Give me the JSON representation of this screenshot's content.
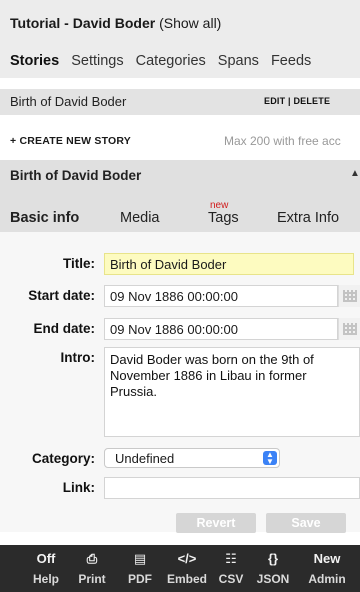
{
  "header": {
    "title_bold": "Tutorial - David Boder",
    "title_link": "(Show all)",
    "nav": [
      "Stories",
      "Settings",
      "Categories",
      "Spans",
      "Feeds"
    ]
  },
  "story_list": {
    "item_name": "Birth of David Boder",
    "edit_label": "EDIT",
    "separator": "|",
    "delete_label": "DELETE"
  },
  "create": {
    "label": "+ CREATE NEW STORY",
    "limit_text": "Max 200 with free acc"
  },
  "story_editor": {
    "title": "Birth of David Boder",
    "tabs": [
      "Basic info",
      "Media",
      "Tags",
      "Extra Info"
    ],
    "tags_badge": "new"
  },
  "form": {
    "title_label": "Title:",
    "title_value": "Birth of David Boder",
    "start_label": "Start date:",
    "start_value": "09 Nov 1886 00:00:00",
    "end_label": "End date:",
    "end_value": "09 Nov 1886 00:00:00",
    "intro_label": "Intro:",
    "intro_value": "David Boder was born on the 9th of November 1886 in Libau in former Prussia.",
    "category_label": "Category:",
    "category_value": "Undefined",
    "link_label": "Link:",
    "link_value": "",
    "revert_label": "Revert",
    "save_label": "Save"
  },
  "footer": [
    {
      "icon": "Off",
      "label": "Help",
      "icon_name": "help-icon"
    },
    {
      "icon": "⎙",
      "label": "Print",
      "icon_name": "print-icon"
    },
    {
      "icon": "▤",
      "label": "PDF",
      "icon_name": "pdf-icon"
    },
    {
      "icon": "</>",
      "label": "Embed",
      "icon_name": "embed-icon"
    },
    {
      "icon": "☷",
      "label": "CSV",
      "icon_name": "csv-icon"
    },
    {
      "icon": "{}",
      "label": "JSON",
      "icon_name": "json-icon"
    },
    {
      "icon": "New",
      "label": "Admin",
      "icon_name": "admin-icon"
    }
  ]
}
